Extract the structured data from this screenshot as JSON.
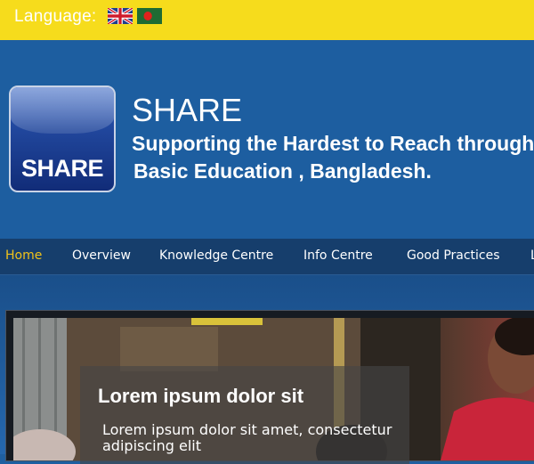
{
  "language_bar": {
    "label": "Language:",
    "flags": [
      {
        "icon": "uk-flag-icon",
        "language": "English"
      },
      {
        "icon": "bangladesh-flag-icon",
        "language": "Bangla"
      }
    ],
    "background": "#f6dc1c"
  },
  "header": {
    "logo_text": "SHARE",
    "title": "SHARE",
    "subtitle_line1": "Supporting the Hardest to Reach through",
    "subtitle_line2": "Basic Education , Bangladesh.",
    "background": "#1d5ea0"
  },
  "nav": {
    "items": [
      {
        "label": "Home",
        "active": true
      },
      {
        "label": "Overview",
        "active": false
      },
      {
        "label": "Knowledge Centre",
        "active": false
      },
      {
        "label": "Info Centre",
        "active": false
      },
      {
        "label": "Good Practices",
        "active": false
      },
      {
        "label": "L",
        "active": false
      }
    ],
    "active_color": "#f0c21a",
    "background": "#163e6c"
  },
  "slider": {
    "caption_title": "Lorem ipsum dolor sit",
    "caption_text": "Lorem ipsum dolor sit amet, consectetur adipiscing elit"
  }
}
